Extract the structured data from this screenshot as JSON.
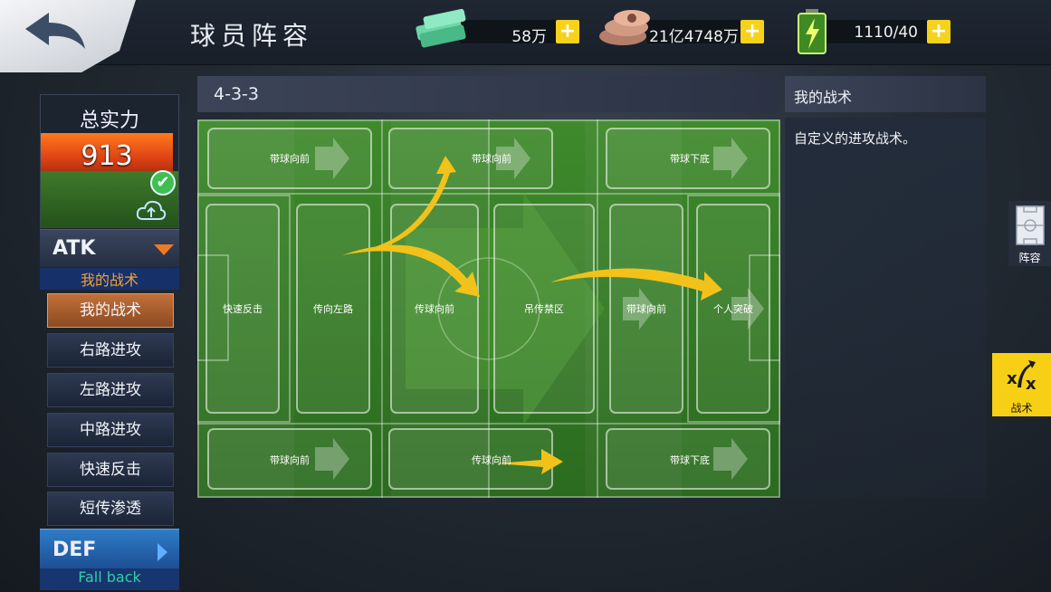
{
  "header": {
    "title": "球员阵容",
    "resources": {
      "cash": "58万",
      "coins": "21亿4748万",
      "energy": "1110/40"
    },
    "plus_label": "+"
  },
  "left_panel": {
    "total_strength_label": "总实力",
    "total_strength_value": "913",
    "atk": {
      "label": "ATK",
      "current": "我的战术",
      "items": [
        "我的战术",
        "右路进攻",
        "左路进攻",
        "中路进攻",
        "快速反击",
        "短传渗透"
      ]
    },
    "def": {
      "label": "DEF",
      "current": "Fall back"
    }
  },
  "formation": "4-3-3",
  "field": {
    "top_zones": [
      "带球向前",
      "带球向前",
      "带球下底"
    ],
    "mid_zones": [
      "快速反击",
      "传向左路",
      "传球向前",
      "吊传禁区",
      "带球向前",
      "个人突破"
    ],
    "bottom_zones": [
      "带球向前",
      "传球向前",
      "带球下底"
    ]
  },
  "right_panel": {
    "title": "我的战术",
    "description": "自定义的进攻战术。"
  },
  "side_tabs": {
    "lineup": "阵容",
    "tactics": "战术"
  }
}
